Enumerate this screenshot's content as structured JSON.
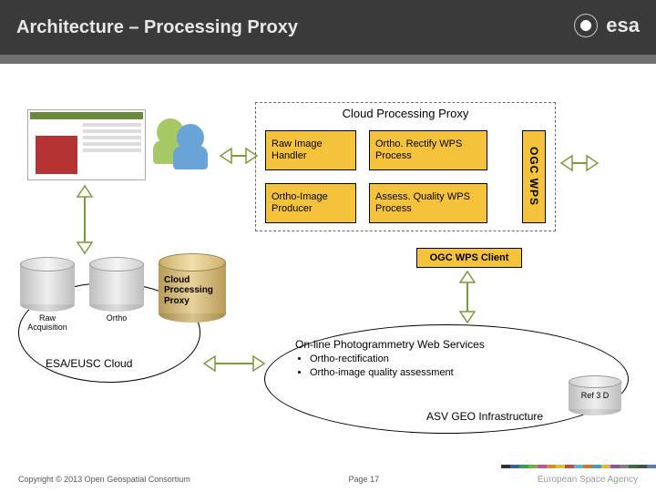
{
  "header": {
    "title": "Architecture – Processing Proxy",
    "logo_text": "esa"
  },
  "cpp": {
    "title": "Cloud Processing Proxy",
    "boxes": {
      "raw": "Raw Image Handler",
      "orthorectify": "Ortho. Rectify WPS Process",
      "producer": "Ortho-Image Producer",
      "assess": "Assess. Quality WPS Process"
    },
    "ogc_wps": "OGC WPS"
  },
  "ogc_client": "OGC WPS Client",
  "cylinders": {
    "raw": "Raw Acquisition",
    "ortho": "Ortho",
    "proxy": "Cloud Processing Proxy"
  },
  "esa_cloud_label": "ESA/EUSC Cloud",
  "asv": {
    "heading": "On-line Photogrammetry Web Services",
    "bullets": [
      "Ortho-rectification",
      "Ortho-image quality assessment"
    ],
    "label": "ASV GEO Infrastructure",
    "ref3d": "Ref 3 D"
  },
  "footer": {
    "copyright": "Copyright © 2013 Open Geospatial Consortium",
    "page": "Page 17",
    "agency": "European Space Agency"
  },
  "colorbar": [
    "#2f2f2f",
    "#3b5fa5",
    "#3f9b52",
    "#71b043",
    "#c94f9a",
    "#d98c2b",
    "#d6c13a",
    "#b3533f",
    "#5bb4d4",
    "#d6742b",
    "#489fb3",
    "#e0b63e",
    "#944c9e",
    "#7f7f7f",
    "#3a6e3f",
    "#4d4d4d",
    "#5b7cc0"
  ]
}
